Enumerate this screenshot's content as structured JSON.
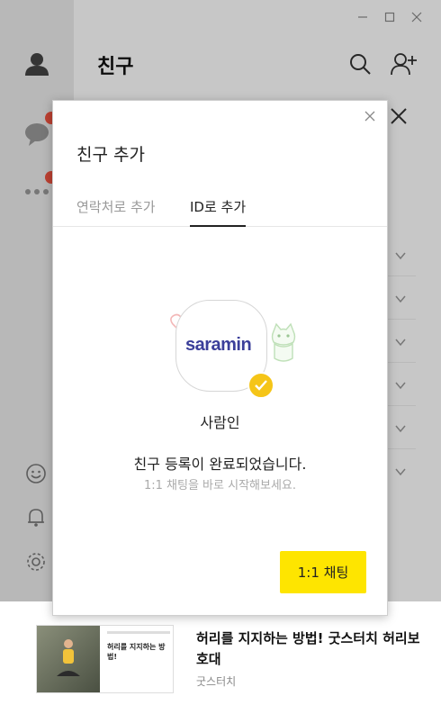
{
  "header": {
    "title": "친구"
  },
  "dialog": {
    "title": "친구 추가",
    "tabs": [
      {
        "label": "연락처로 추가",
        "active": false
      },
      {
        "label": "ID로 추가",
        "active": true
      }
    ],
    "profile": {
      "logo_text_main": "saramin",
      "name": "사람인"
    },
    "message": "친구 등록이 완료되었습니다.",
    "sub_message": "1:1 채팅을 바로 시작해보세요.",
    "chat_button": "1:1 채팅"
  },
  "ad": {
    "thumb_text": "허리를 지지하는 방법!",
    "title": "허리를 지지하는 방법! 굿스터치 허리보호대",
    "source": "굿스터치"
  },
  "colors": {
    "accent": "#fee500",
    "badge": "#f0533f",
    "check": "#f5c518",
    "brand_logo": "#3b3f9a"
  }
}
